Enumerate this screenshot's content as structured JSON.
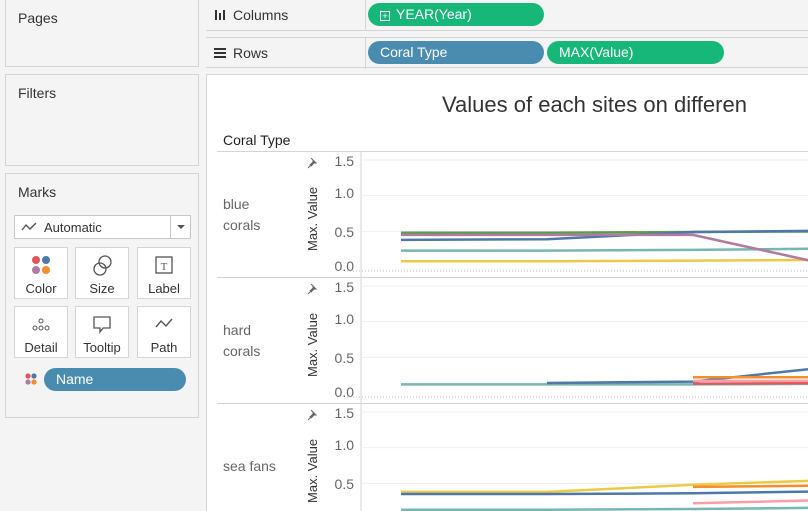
{
  "pages": {
    "title": "Pages"
  },
  "filters": {
    "title": "Filters"
  },
  "marks": {
    "title": "Marks",
    "mark_type": "Automatic",
    "buttons": [
      "Color",
      "Size",
      "Label",
      "Detail",
      "Tooltip",
      "Path"
    ],
    "color_pill": "Name"
  },
  "columns": {
    "label": "Columns",
    "pill": "YEAR(Year)"
  },
  "rows": {
    "label": "Rows",
    "pills": [
      "Coral Type",
      "MAX(Value)"
    ]
  },
  "view": {
    "title": "Values of each sites  on differen",
    "row_header": "Coral Type",
    "panes": [
      {
        "label": "blue\ncorals",
        "axis_title": "Max. Value",
        "ticks": [
          "1.5",
          "1.0",
          "0.5",
          "0.0"
        ]
      },
      {
        "label": "hard\ncorals",
        "axis_title": "Max. Value",
        "ticks": [
          "1.5",
          "1.0",
          "0.5",
          "0.0"
        ]
      },
      {
        "label": "sea fans",
        "axis_title": "Max. Value",
        "ticks": [
          "1.5",
          "1.0",
          "0.5"
        ]
      }
    ]
  },
  "colors": {
    "blue_pill": "#4a8cb0",
    "green_pill": "#17b77a"
  },
  "chart_data": {
    "type": "line",
    "ylim": [
      0,
      1.5
    ],
    "panes": [
      {
        "name": "blue corals",
        "series": [
          {
            "color": "#5a9e4b",
            "values": [
              0.48,
              0.48,
              0.49,
              0.5
            ]
          },
          {
            "color": "#4e79a7",
            "values": [
              0.38,
              0.39,
              0.49,
              0.51
            ]
          },
          {
            "color": "#76b7b2",
            "values": [
              0.23,
              0.23,
              0.24,
              0.26
            ]
          },
          {
            "color": "#edc948",
            "values": [
              0.08,
              0.08,
              0.09,
              0.1
            ]
          },
          {
            "color": "#b07aa1",
            "values": [
              0.45,
              0.45,
              0.45,
              0.0
            ]
          }
        ]
      },
      {
        "name": "hard corals",
        "series": [
          {
            "color": "#76b7b2",
            "values": [
              0.12,
              0.12,
              0.12,
              0.13
            ]
          },
          {
            "color": "#4e79a7",
            "values": [
              null,
              0.14,
              0.16,
              0.38
            ]
          },
          {
            "color": "#f28e2b",
            "values": [
              null,
              null,
              0.22,
              0.22
            ]
          },
          {
            "color": "#e15759",
            "values": [
              null,
              null,
              0.13,
              0.14
            ]
          },
          {
            "color": "#ff9da7",
            "values": [
              null,
              null,
              0.17,
              0.17
            ]
          }
        ]
      },
      {
        "name": "sea fans",
        "series": [
          {
            "color": "#edc948",
            "values": [
              0.38,
              0.38,
              0.48,
              0.55
            ]
          },
          {
            "color": "#4e79a7",
            "values": [
              0.35,
              0.35,
              0.36,
              0.39
            ]
          },
          {
            "color": "#f28e2b",
            "values": [
              null,
              null,
              0.45,
              0.47
            ]
          },
          {
            "color": "#ff9da7",
            "values": [
              null,
              null,
              0.22,
              0.27
            ]
          },
          {
            "color": "#76b7b2",
            "values": [
              0.13,
              0.13,
              0.14,
              0.16
            ]
          }
        ]
      }
    ]
  }
}
